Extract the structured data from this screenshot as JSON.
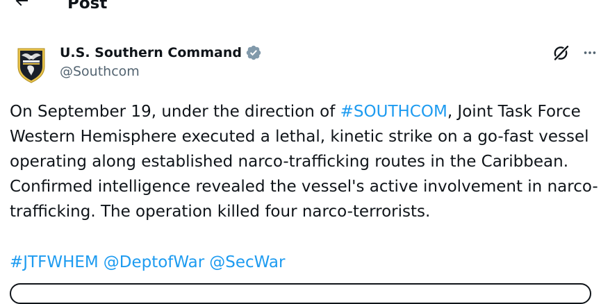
{
  "header": {
    "back_icon": "arrow-left-icon",
    "title": "Post"
  },
  "author": {
    "display_name": "U.S. Southern Command",
    "handle": "@Southcom",
    "verified_icon": "verified-badge-icon",
    "verified_color": "#829aab",
    "avatar_icon": "southcom-seal-icon"
  },
  "actions": {
    "grok_icon": "grok-icon",
    "more_icon": "more-horizontal-icon"
  },
  "tweet": {
    "line1_pre": "On September 19, under the direction of ",
    "line1_link": "#SOUTHCOM",
    "line1_post": ", Joint Task Force",
    "line2": "Western Hemisphere executed a lethal, kinetic strike on a go-fast vessel",
    "line3": "operating along established narco-trafficking routes in the Caribbean.",
    "line4": "Confirmed intelligence revealed the vessel's active involvement in narco-",
    "line5": "trafficking. The operation killed four narco-terrorists.",
    "tags": [
      "#JTFWHEM",
      "@DeptofWar",
      "@SecWar"
    ]
  },
  "colors": {
    "link": "#1d9bf0",
    "text": "#0f1419",
    "secondary": "#536471"
  }
}
